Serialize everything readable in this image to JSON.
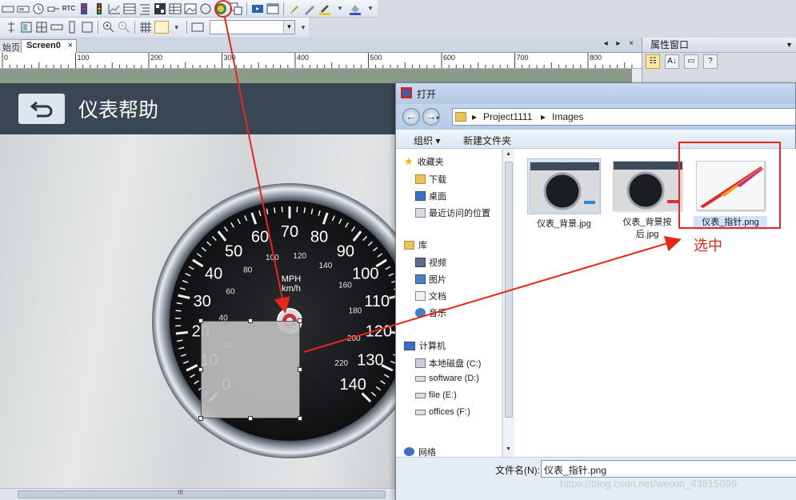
{
  "toolbar": {
    "rtc_label": "RTC"
  },
  "tabs": {
    "home_label": "始页",
    "screen_label": "Screen0",
    "close_glyph": "×",
    "pane_controls": "◂ ▸ ×"
  },
  "ruler": {
    "ticks": [
      "0",
      "100",
      "200",
      "300",
      "400",
      "500",
      "600",
      "700",
      "800"
    ]
  },
  "properties": {
    "title": "属性窗口",
    "help_glyph": "?"
  },
  "screen": {
    "title": "仪表帮助",
    "gauge": {
      "outer_labels": [
        "0",
        "10",
        "20",
        "30",
        "40",
        "50",
        "60",
        "70",
        "80",
        "90",
        "100",
        "110",
        "120",
        "130",
        "140"
      ],
      "inner_labels": [
        "20",
        "40",
        "60",
        "80",
        "100",
        "120",
        "140",
        "160",
        "180",
        "200",
        "220"
      ],
      "unit_mph": "MPH",
      "unit_kmh": "km/h"
    }
  },
  "dialog": {
    "title": "打开",
    "breadcrumbs": [
      "Project1111",
      "Images"
    ],
    "organize_label": "组织 ▾",
    "new_folder_label": "新建文件夹",
    "favorites": {
      "group": "收藏夹",
      "items": [
        "下载",
        "桌面",
        "最近访问的位置"
      ]
    },
    "libraries": {
      "group": "库",
      "items": [
        "视频",
        "图片",
        "文档",
        "音乐"
      ]
    },
    "computer": {
      "group": "计算机",
      "items": [
        "本地磁盘 (C:)",
        "software (D:)",
        "file (E:)",
        "offices (F:)"
      ]
    },
    "network_label": "网络",
    "files": [
      {
        "name": "仪表_背景.jpg"
      },
      {
        "name": "仪表_背景按后.jpg"
      },
      {
        "name": "仪表_指针.png"
      }
    ],
    "filename_label": "文件名(N):",
    "filename_value": "仪表_指针.png"
  },
  "annotation": {
    "selected_text": "选中",
    "color": "#e8261c"
  },
  "watermark": "https://blog.csdn.net/weixin_43815099"
}
